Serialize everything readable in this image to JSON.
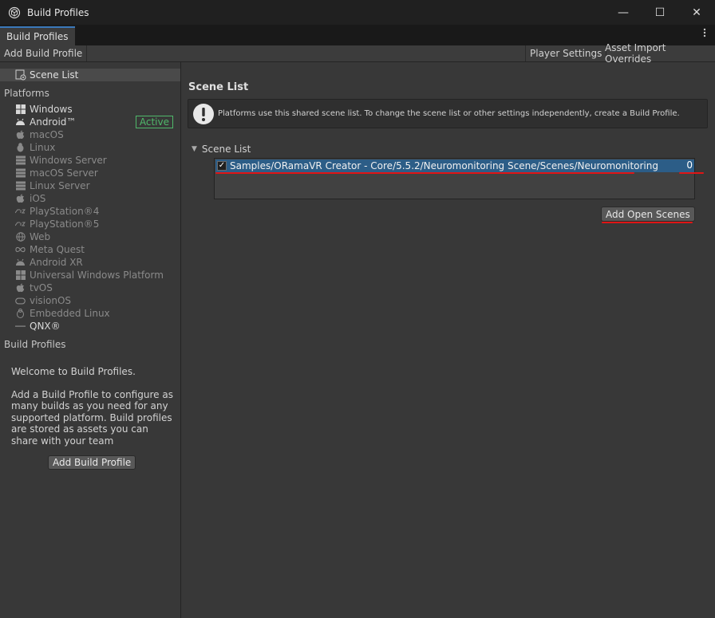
{
  "window": {
    "title": "Build Profiles",
    "controls": {
      "minimize": "—",
      "maximize": "☐",
      "close": "✕"
    }
  },
  "tabs": [
    {
      "label": "Build Profiles",
      "active": true
    }
  ],
  "toolbar": {
    "add_build_profile": "Add Build Profile",
    "player_settings": "Player Settings",
    "asset_import_overrides": "Asset Import Overrides"
  },
  "sidebar": {
    "scene_list_label": "Scene List",
    "platforms_heading": "Platforms",
    "platforms": [
      {
        "label": "Windows",
        "icon": "windows-icon",
        "enabled": true
      },
      {
        "label": "Android™",
        "icon": "android-icon",
        "enabled": true,
        "badge": "Active"
      },
      {
        "label": "macOS",
        "icon": "apple-icon",
        "enabled": false
      },
      {
        "label": "Linux",
        "icon": "linux-icon",
        "enabled": false
      },
      {
        "label": "Windows Server",
        "icon": "server-icon",
        "enabled": false
      },
      {
        "label": "macOS Server",
        "icon": "server-icon",
        "enabled": false
      },
      {
        "label": "Linux Server",
        "icon": "server-icon",
        "enabled": false
      },
      {
        "label": "iOS",
        "icon": "apple-icon",
        "enabled": false
      },
      {
        "label": "PlayStation®4",
        "icon": "ps4-icon",
        "enabled": false
      },
      {
        "label": "PlayStation®5",
        "icon": "ps5-icon",
        "enabled": false
      },
      {
        "label": "Web",
        "icon": "globe-icon",
        "enabled": false
      },
      {
        "label": "Meta Quest",
        "icon": "meta-icon",
        "enabled": false
      },
      {
        "label": "Android XR",
        "icon": "android-icon",
        "enabled": false
      },
      {
        "label": "Universal Windows Platform",
        "icon": "windows-icon",
        "enabled": false
      },
      {
        "label": "tvOS",
        "icon": "apple-icon",
        "enabled": false
      },
      {
        "label": "visionOS",
        "icon": "vision-icon",
        "enabled": false
      },
      {
        "label": "Embedded Linux",
        "icon": "linux-icon",
        "enabled": false
      },
      {
        "label": "QNX®",
        "icon": "qnx-icon",
        "enabled": true
      }
    ],
    "build_profiles_heading": "Build Profiles",
    "welcome_title": "Welcome to Build Profiles.",
    "welcome_body": "Add a Build Profile to configure as many builds as you need for any supported platform. Build profiles are stored as assets you can share with your team",
    "add_build_profile_button": "Add Build Profile"
  },
  "main": {
    "title": "Scene List",
    "help_message": "Platforms use this shared scene list. To change the scene list or other settings independently, create a Build Profile.",
    "foldout_label": "Scene List",
    "scenes": [
      {
        "path": "Samples/ORamaVR Creator - Core/5.5.2/Neuromonitoring Scene/Scenes/Neuromonitoring",
        "index": "0",
        "checked": true,
        "check_glyph": "✓"
      }
    ],
    "add_open_scenes_button": "Add Open Scenes"
  },
  "colors": {
    "accent_tab": "#3a79bb",
    "selection": "#2c5d87",
    "active_badge": "#4fb86a",
    "annotation_underline": "#e01515"
  }
}
